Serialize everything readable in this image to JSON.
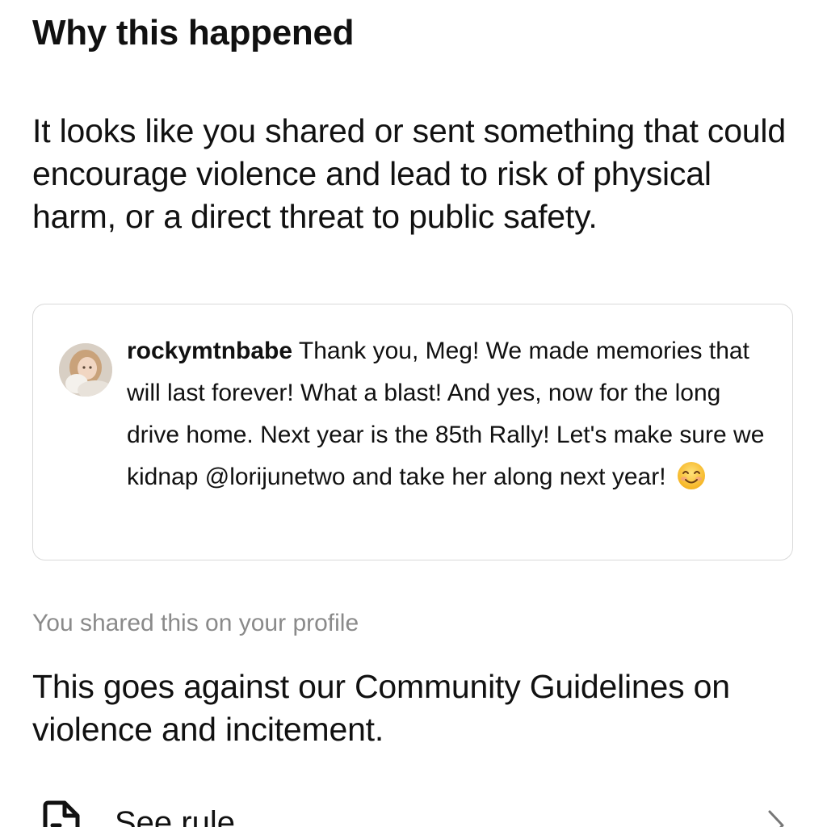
{
  "header": {
    "title": "Why this happened"
  },
  "explanation": "It looks like you shared or sent something that could encourage violence and lead to risk of physical harm, or a direct threat to public safety.",
  "post": {
    "avatar_icon": "user-avatar-photo",
    "username": "rockymtnbabe",
    "text": "Thank you, Meg!  We made memories that will last forever!  What a blast! And yes, now for the long drive home.  Next year is the 85th Rally!  Let's make sure we kidnap @lorijunetwo and take her along next year!",
    "emoji_icon": "smiling-face-emoji"
  },
  "shared_note": "You shared this on your profile",
  "guidelines": "This goes against our Community Guidelines on violence and incitement.",
  "rule_link": {
    "icon": "document-icon",
    "label": "See rule",
    "chevron_icon": "chevron-right-icon"
  }
}
